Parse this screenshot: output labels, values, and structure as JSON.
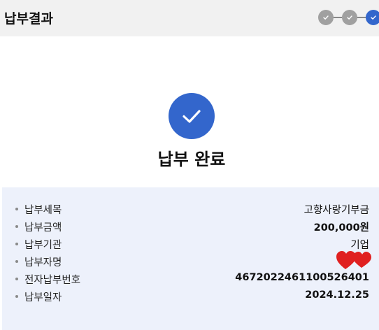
{
  "header": {
    "title": "납부결과",
    "steps": [
      "done",
      "done",
      "current"
    ]
  },
  "hero": {
    "icon": "check-icon",
    "title": "납부 완료"
  },
  "details": [
    {
      "label": "납부세목",
      "value": "고향사랑기부금"
    },
    {
      "label": "납부금액",
      "value": "200,000원"
    },
    {
      "label": "납부기관",
      "value": "기업"
    },
    {
      "label": "납부자명",
      "value": "",
      "redacted": true
    },
    {
      "label": "전자납부번호",
      "value": "4672022461100526401"
    },
    {
      "label": "납부일자",
      "value": "2024.12.25"
    }
  ],
  "colors": {
    "accent": "#3366cc",
    "step_done": "#a0a0a0",
    "panel_bg": "#edf1fb",
    "header_bg": "#f1f1f1",
    "redact": "#e02020"
  }
}
